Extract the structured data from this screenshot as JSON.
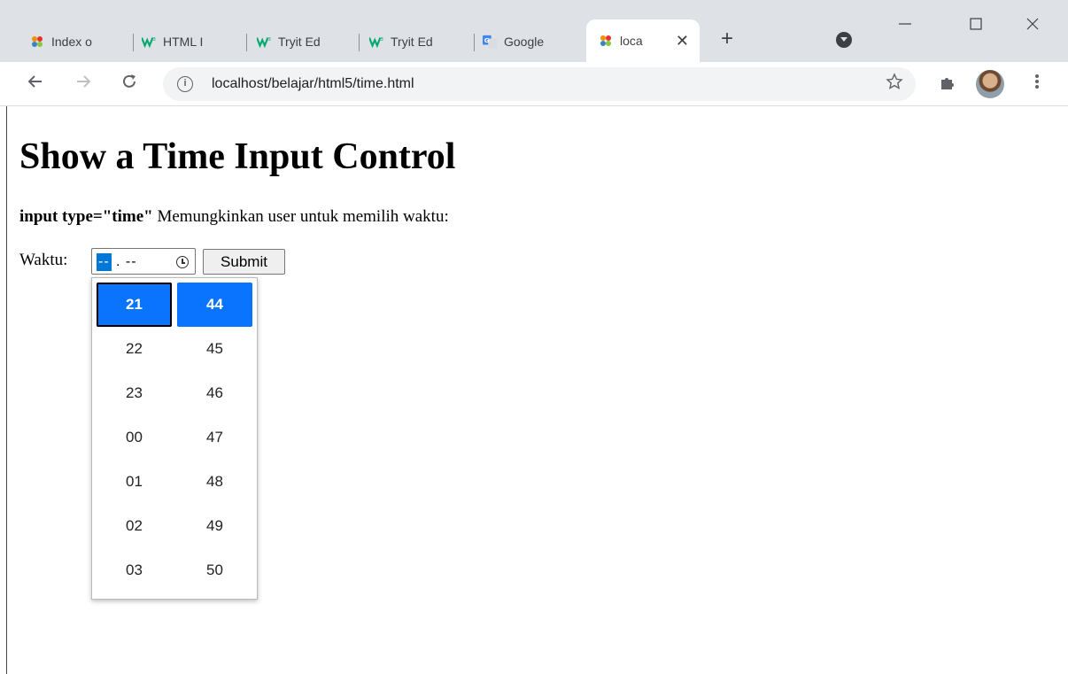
{
  "browser": {
    "tabs": [
      {
        "title": "Index o",
        "icon": "xampp-icon"
      },
      {
        "title": "HTML I",
        "icon": "w3schools-icon"
      },
      {
        "title": "Tryit Ed",
        "icon": "w3schools-icon"
      },
      {
        "title": "Tryit Ed",
        "icon": "w3schools-icon"
      },
      {
        "title": "Google",
        "icon": "google-translate-icon"
      },
      {
        "title": "loca",
        "icon": "xampp-icon",
        "active": true
      }
    ],
    "close_glyph": "✕",
    "new_tab_glyph": "+",
    "url": "localhost/belajar/html5/time.html",
    "info_glyph": "i",
    "colors": {
      "tabstrip": "#dee1e6",
      "accent": "#0a74ff"
    }
  },
  "page": {
    "heading": "Show a Time Input Control",
    "desc_bold": "input type=\"time\"",
    "desc_rest": " Memungkinkan user untuk memilih waktu:",
    "label": "Waktu:",
    "time_value_hour": "--",
    "time_value_rest": ". --",
    "submit_label": "Submit"
  },
  "picker": {
    "hours": [
      "21",
      "22",
      "23",
      "00",
      "01",
      "02",
      "03"
    ],
    "minutes": [
      "44",
      "45",
      "46",
      "47",
      "48",
      "49",
      "50"
    ],
    "selected_hour": "21",
    "selected_minute": "44"
  }
}
